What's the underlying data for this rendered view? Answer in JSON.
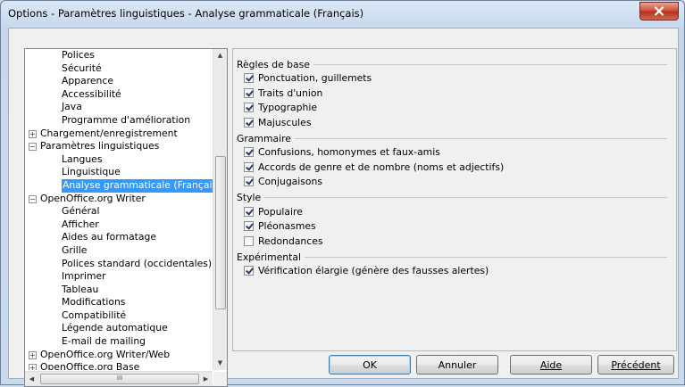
{
  "window": {
    "title": "Options - Paramètres linguistiques - Analyse grammaticale (Français)",
    "close_label": "x"
  },
  "tree": {
    "rows": [
      {
        "label": "Polices",
        "level": 1
      },
      {
        "label": "Sécurité",
        "level": 1
      },
      {
        "label": "Apparence",
        "level": 1
      },
      {
        "label": "Accessibilité",
        "level": 1
      },
      {
        "label": "Java",
        "level": 1
      },
      {
        "label": "Programme d'amélioration",
        "level": 1
      },
      {
        "label": "Chargement/enregistrement",
        "level": 0,
        "expander": "+"
      },
      {
        "label": "Paramètres linguistiques",
        "level": 0,
        "expander": "−"
      },
      {
        "label": "Langues",
        "level": 1
      },
      {
        "label": "Linguistique",
        "level": 1
      },
      {
        "label": "Analyse grammaticale (Français)",
        "level": 1,
        "selected": true
      },
      {
        "label": "OpenOffice.org Writer",
        "level": 0,
        "expander": "−"
      },
      {
        "label": "Général",
        "level": 1
      },
      {
        "label": "Afficher",
        "level": 1
      },
      {
        "label": "Aides au formatage",
        "level": 1
      },
      {
        "label": "Grille",
        "level": 1
      },
      {
        "label": "Polices standard (occidentales)",
        "level": 1
      },
      {
        "label": "Imprimer",
        "level": 1
      },
      {
        "label": "Tableau",
        "level": 1
      },
      {
        "label": "Modifications",
        "level": 1
      },
      {
        "label": "Compatibilité",
        "level": 1
      },
      {
        "label": "Légende automatique",
        "level": 1
      },
      {
        "label": "E-mail de mailing",
        "level": 1
      },
      {
        "label": "OpenOffice.org Writer/Web",
        "level": 0,
        "expander": "+"
      },
      {
        "label": "OpenOffice.org Base",
        "level": 0,
        "expander": "+"
      }
    ],
    "hscroll_grip": "III"
  },
  "groups": [
    {
      "title": "Règles de base",
      "options": [
        {
          "label": "Ponctuation, guillemets",
          "checked": true
        },
        {
          "label": "Traits d'union",
          "checked": true
        },
        {
          "label": "Typographie",
          "checked": true
        },
        {
          "label": "Majuscules",
          "checked": true
        }
      ]
    },
    {
      "title": "Grammaire",
      "options": [
        {
          "label": "Confusions, homonymes et faux-amis",
          "checked": true
        },
        {
          "label": "Accords de genre et de nombre (noms et adjectifs)",
          "checked": true
        },
        {
          "label": "Conjugaisons",
          "checked": true
        }
      ]
    },
    {
      "title": "Style",
      "options": [
        {
          "label": "Populaire",
          "checked": true
        },
        {
          "label": "Pléonasmes",
          "checked": true
        },
        {
          "label": "Redondances",
          "checked": false
        }
      ]
    },
    {
      "title": "Expérimental",
      "options": [
        {
          "label": "Vérification élargie (génère des fausses alertes)",
          "checked": true
        }
      ]
    }
  ],
  "buttons": {
    "ok": "OK",
    "cancel": "Annuler",
    "help": "Aide",
    "back": "Précédent"
  }
}
